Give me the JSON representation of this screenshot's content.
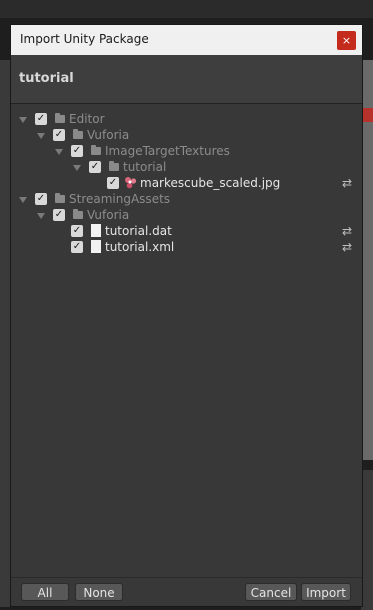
{
  "dialog": {
    "title": "Import Unity Package",
    "close_glyph": "×",
    "package_name": "tutorial"
  },
  "tree": [
    {
      "label": "Editor",
      "type": "folder",
      "checked": true,
      "expanded": true,
      "depth": 0,
      "dim": true
    },
    {
      "label": "Vuforia",
      "type": "folder",
      "checked": true,
      "expanded": true,
      "depth": 1,
      "dim": true
    },
    {
      "label": "ImageTargetTextures",
      "type": "folder",
      "checked": true,
      "expanded": true,
      "depth": 2,
      "dim": true
    },
    {
      "label": "tutorial",
      "type": "folder",
      "checked": true,
      "expanded": true,
      "depth": 3,
      "dim": true
    },
    {
      "label": "markescube_scaled.jpg",
      "type": "image",
      "checked": true,
      "depth": 4,
      "dim": false,
      "changed": true
    },
    {
      "label": "StreamingAssets",
      "type": "folder",
      "checked": true,
      "expanded": true,
      "depth": 0,
      "dim": true
    },
    {
      "label": "Vuforia",
      "type": "folder",
      "checked": true,
      "expanded": true,
      "depth": 1,
      "dim": true
    },
    {
      "label": "tutorial.dat",
      "type": "file",
      "checked": true,
      "depth": 2,
      "dim": false,
      "changed": true
    },
    {
      "label": "tutorial.xml",
      "type": "file",
      "checked": true,
      "depth": 2,
      "dim": false,
      "changed": true
    }
  ],
  "icons": {
    "check": "✓",
    "changed": "⇄"
  },
  "footer": {
    "all_label": "All",
    "none_label": "None",
    "cancel_label": "Cancel",
    "import_label": "Import"
  }
}
